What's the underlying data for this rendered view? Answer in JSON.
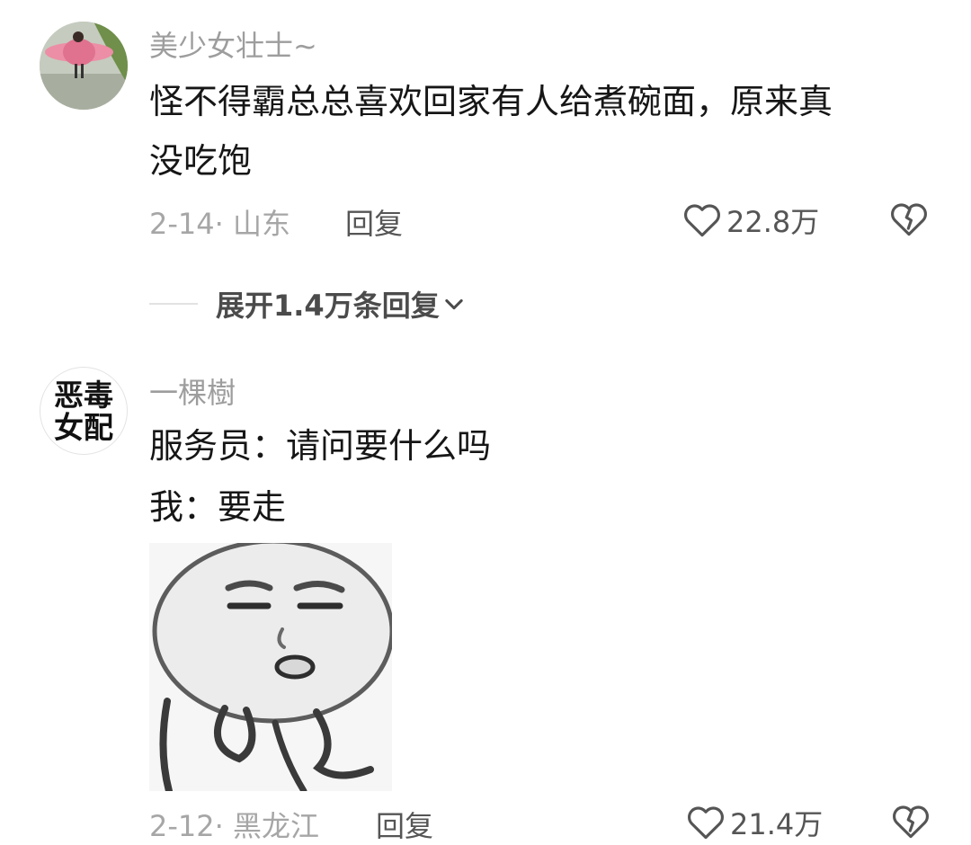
{
  "comments": [
    {
      "username": "美少女壮士~",
      "lines": [
        "怪不得霸总总喜欢回家有人给煮碗面，原来真",
        "没吃饱"
      ],
      "meta": "2-14· 山东",
      "reply_label": "回复",
      "likes": "22.8万"
    },
    {
      "username": "一棵樹",
      "avatar_text": [
        "恶毒",
        "女配"
      ],
      "lines": [
        "服务员：请问要什么吗",
        "我：要走"
      ],
      "meta": "2-12· 黑龙江",
      "reply_label": "回复",
      "likes": "21.4万"
    }
  ],
  "expand_replies": "展开1.4万条回复",
  "icons": {
    "like": "heart-outline-icon",
    "dislike": "broken-heart-icon",
    "expand": "chevron-down-icon"
  },
  "colors": {
    "text": "#161616",
    "muted": "#a6a6a6",
    "action": "#555555"
  }
}
